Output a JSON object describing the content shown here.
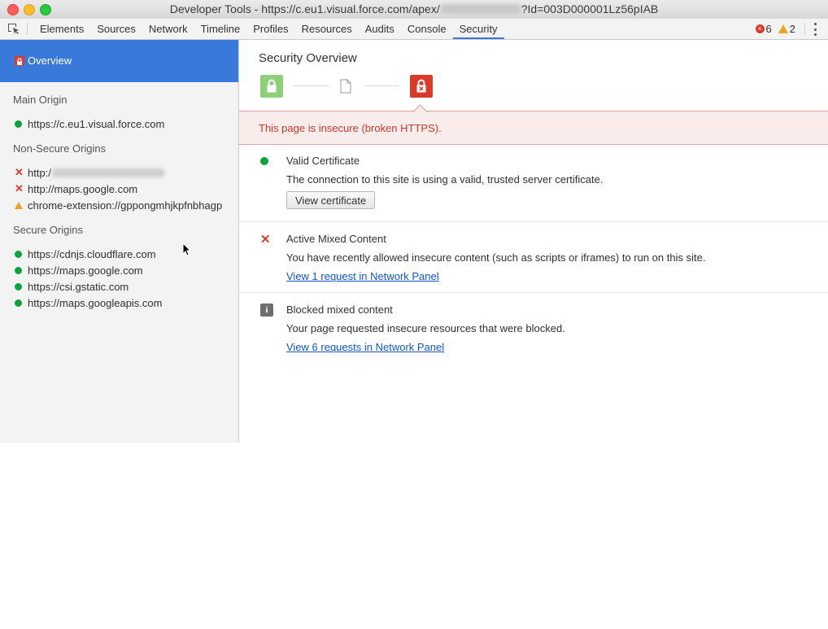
{
  "window": {
    "title_prefix": "Developer Tools - https://c.eu1.visual.force.com/apex/",
    "title_suffix": "?Id=003D000001Lz56pIAB"
  },
  "toolbar": {
    "tabs": [
      {
        "label": "Elements"
      },
      {
        "label": "Sources"
      },
      {
        "label": "Network"
      },
      {
        "label": "Timeline"
      },
      {
        "label": "Profiles"
      },
      {
        "label": "Resources"
      },
      {
        "label": "Audits"
      },
      {
        "label": "Console"
      },
      {
        "label": "Security",
        "active": true
      }
    ],
    "error_count": "6",
    "warning_count": "2"
  },
  "sidebar": {
    "overview_label": "Overview",
    "main_origin_heading": "Main Origin",
    "main_origin": "https://c.eu1.visual.force.com",
    "non_secure_heading": "Non-Secure Origins",
    "non_secure": [
      {
        "text": "http:/",
        "status": "insecure",
        "icon": "x-icon"
      },
      {
        "text": "http://maps.google.com",
        "status": "insecure",
        "icon": "x-icon"
      },
      {
        "text": "chrome-extension://gppongmhjkpfnbhagp",
        "status": "warning",
        "icon": "warning-triangle-icon"
      }
    ],
    "secure_heading": "Secure Origins",
    "secure": [
      {
        "text": "https://cdnjs.cloudflare.com"
      },
      {
        "text": "https://maps.google.com"
      },
      {
        "text": "https://csi.gstatic.com"
      },
      {
        "text": "https://maps.googleapis.com"
      }
    ]
  },
  "main": {
    "title": "Security Overview",
    "banner": "This page is insecure (broken HTTPS).",
    "certificate": {
      "title": "Valid Certificate",
      "desc": "The connection to this site is using a valid, trusted server certificate.",
      "button": "View certificate"
    },
    "mixed": {
      "title": "Active Mixed Content",
      "desc": "You have recently allowed insecure content (such as scripts or iframes) to run on this site.",
      "link": "View 1 request in Network Panel"
    },
    "blocked": {
      "title": "Blocked mixed content",
      "desc": "Your page requested insecure resources that were blocked.",
      "link": "View 6 requests in Network Panel"
    }
  },
  "colors": {
    "accent": "#3879d9",
    "secure": "#0ba33c",
    "insecure": "#db3b2b",
    "warning": "#f1a21f",
    "link": "#1155cc"
  }
}
